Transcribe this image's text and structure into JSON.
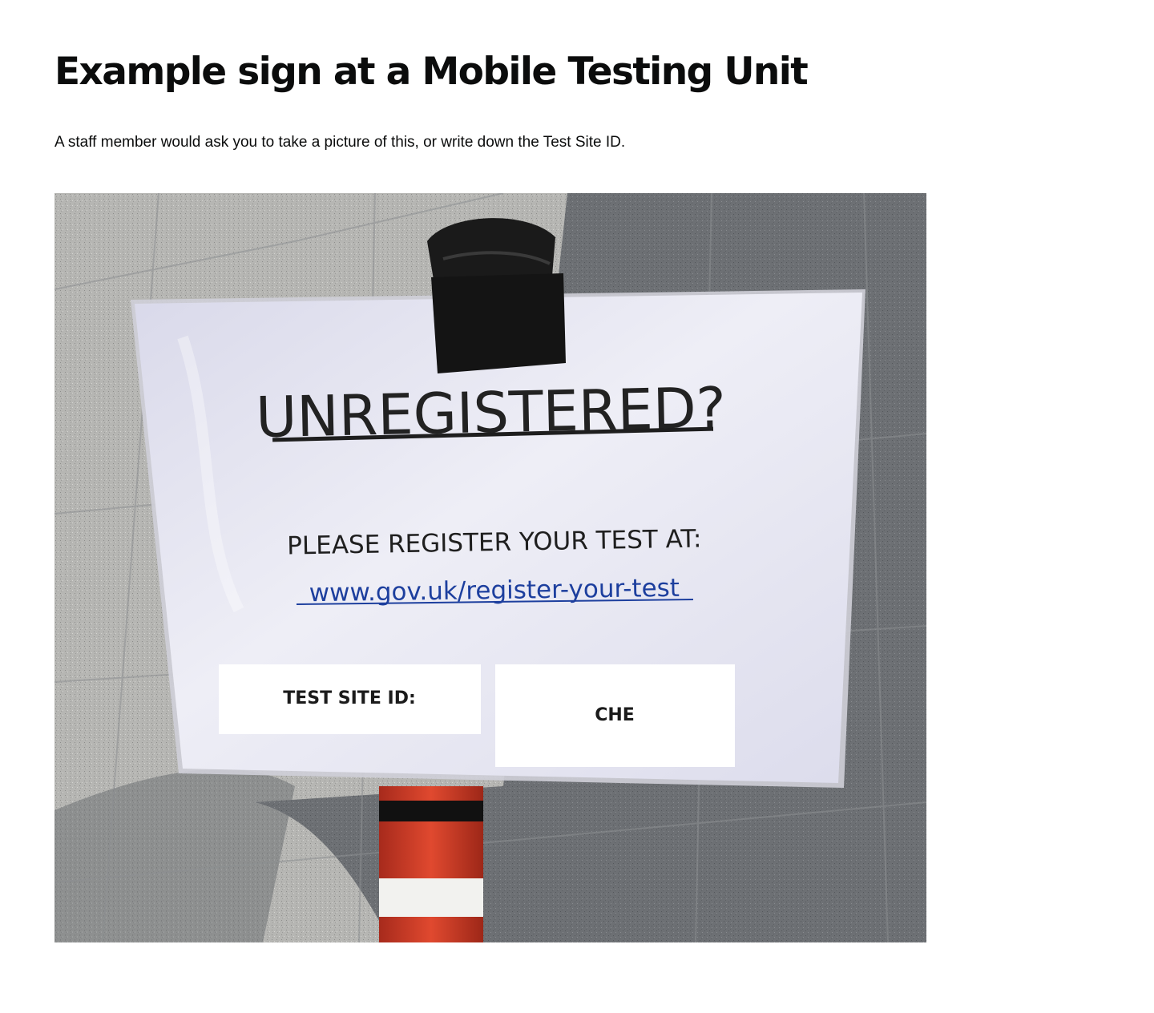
{
  "page": {
    "title": "Example sign at a Mobile Testing Unit",
    "lede": "A staff member would ask you to take a picture of this, or write down the Test Site ID."
  },
  "sign_photo": {
    "heading": "UNREGISTERED?",
    "instruction": "PLEASE REGISTER YOUR TEST AT:",
    "url": "www.gov.uk/register-your-test",
    "site_id_label": "TEST SITE ID:",
    "site_id_value": "CHE"
  },
  "colors": {
    "text": "#0b0c0c",
    "link_blue": "#1d3f9e",
    "pavement_light": "#b9b9b6",
    "pavement_shadow": "#6f7276",
    "sign_paper": "#e8e8f2",
    "tape": "#141414",
    "post_red": "#d7412c"
  }
}
